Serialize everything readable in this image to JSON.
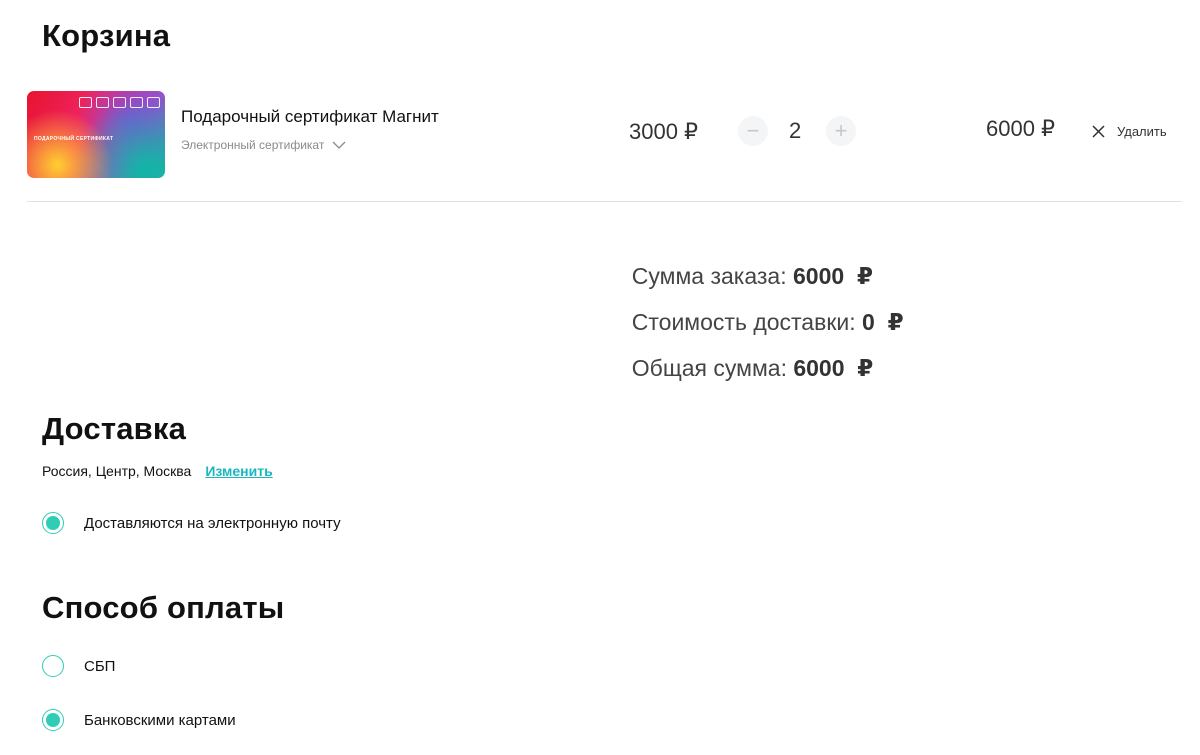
{
  "cart": {
    "title": "Корзина",
    "item": {
      "name": "Подарочный сертификат Магнит",
      "variant": "Электронный сертификат",
      "card_text": "ПОДАРОЧНЫЙ СЕРТИФИКАТ",
      "price": "3000 ₽",
      "quantity": "2",
      "minus": "−",
      "plus": "+",
      "total": "6000 ₽",
      "delete_label": "Удалить"
    }
  },
  "summary": {
    "order_label": "Сумма заказа: ",
    "order_value": "6000  ₽",
    "delivery_label": "Стоимость доставки: ",
    "delivery_value": "0  ₽",
    "grand_label": "Общая сумма: ",
    "grand_value": "6000  ₽"
  },
  "delivery": {
    "title": "Доставка",
    "region": "Россия, Центр, Москва",
    "change_label": "Изменить",
    "option": "Доставляются на электронную почту"
  },
  "payment": {
    "title": "Способ оплаты",
    "options": [
      {
        "label": "СБП",
        "selected": false
      },
      {
        "label": "Банковскими картами",
        "selected": true
      }
    ]
  },
  "colors": {
    "accent": "#2fcdb6",
    "link": "#18b7c1"
  }
}
